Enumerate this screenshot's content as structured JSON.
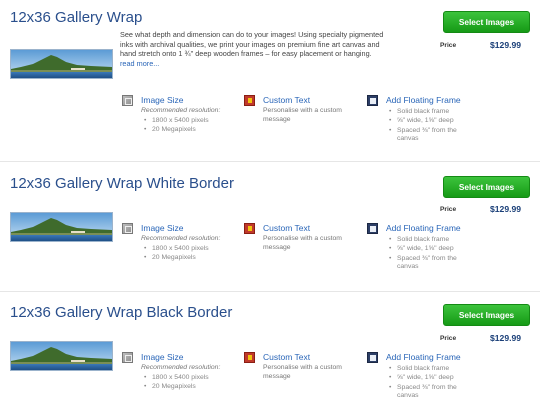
{
  "products": [
    {
      "title": "12x36 Gallery Wrap",
      "description": "See what depth and dimension can do to your images! Using specialty pigmented inks with archival qualities, we print your images on premium fine art canvas and hand stretch onto 1 ¾\" deep wooden frames – for easy placement or hanging.",
      "read_more": "read more...",
      "button_label": "Select Images",
      "price_label": "Price",
      "price": "$129.99",
      "features": {
        "size": {
          "title": "Image Size",
          "subtitle": "Recommended resolution:",
          "bullets": [
            "1800 x 5400 pixels",
            "20 Megapixels"
          ]
        },
        "text": {
          "title": "Custom Text",
          "subtitle": "Personalise with a custom",
          "subtitle2": "message"
        },
        "frame": {
          "title": "Add Floating Frame",
          "bullets": [
            "Solid black frame",
            "⅝\" wide, 1⅝\" deep",
            "Spaced ⅜\" from the",
            "canvas"
          ]
        }
      }
    },
    {
      "title": "12x36 Gallery Wrap White Border",
      "button_label": "Select Images",
      "price_label": "Price",
      "price": "$129.99",
      "features": {
        "size": {
          "title": "Image Size",
          "subtitle": "Recommended resolution:",
          "bullets": [
            "1800 x 5400 pixels",
            "20 Megapixels"
          ]
        },
        "text": {
          "title": "Custom Text",
          "subtitle": "Personalise with a custom",
          "subtitle2": "message"
        },
        "frame": {
          "title": "Add Floating Frame",
          "bullets": [
            "Solid black frame",
            "⅝\" wide, 1⅝\" deep",
            "Spaced ⅜\" from the",
            "canvas"
          ]
        }
      }
    },
    {
      "title": "12x36 Gallery Wrap Black Border",
      "button_label": "Select Images",
      "price_label": "Price",
      "price": "$129.99",
      "features": {
        "size": {
          "title": "Image Size",
          "subtitle": "Recommended resolution:",
          "bullets": [
            "1800 x 5400 pixels",
            "20 Megapixels"
          ]
        },
        "text": {
          "title": "Custom Text",
          "subtitle": "Personalise with a custom",
          "subtitle2": "message"
        },
        "frame": {
          "title": "Add Floating Frame",
          "bullets": [
            "Solid black frame",
            "⅝\" wide, 1⅝\" deep",
            "Spaced ⅜\" from the",
            "canvas"
          ]
        }
      }
    }
  ],
  "icons": {
    "size": "image-size-icon",
    "text": "custom-text-icon",
    "frame": "floating-frame-icon"
  },
  "colors": {
    "title": "#2a4f8c",
    "link": "#2a66b8",
    "button": "#169a16",
    "price": "#1a3f78"
  }
}
